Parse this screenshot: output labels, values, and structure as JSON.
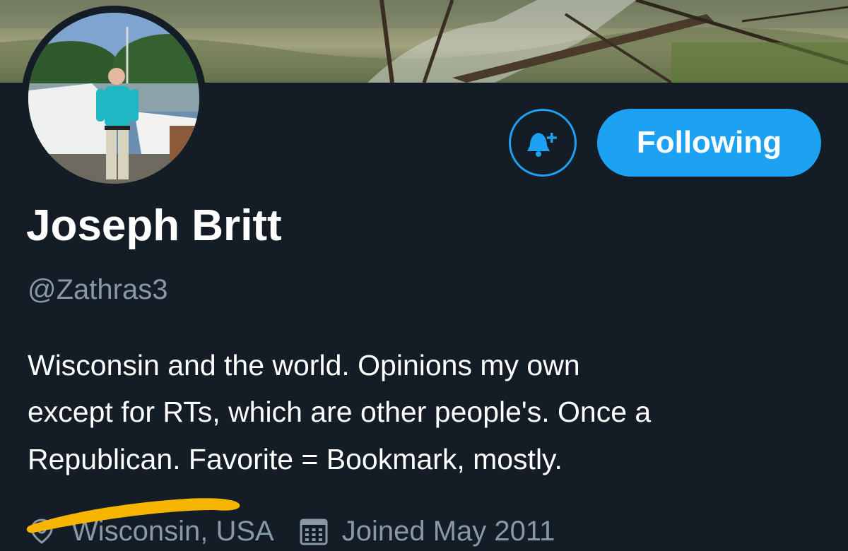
{
  "profile": {
    "display_name": "Joseph Britt",
    "handle": "@Zathras3",
    "bio_lines": [
      "Wisconsin and the world. Opinions my own",
      "except for RTs, which are other people's.  Once a",
      "Republican.  Favorite = Bookmark, mostly."
    ],
    "location": "Wisconsin, USA",
    "joined": "Joined May 2011"
  },
  "actions": {
    "following_label": "Following"
  },
  "icons": {
    "notify": "bell-plus-icon",
    "location": "location-pin-icon",
    "joined": "calendar-icon"
  },
  "colors": {
    "background": "#141d26",
    "accent": "#1da1f2",
    "secondary_text": "#8899a6",
    "redaction": "#f7b500"
  }
}
